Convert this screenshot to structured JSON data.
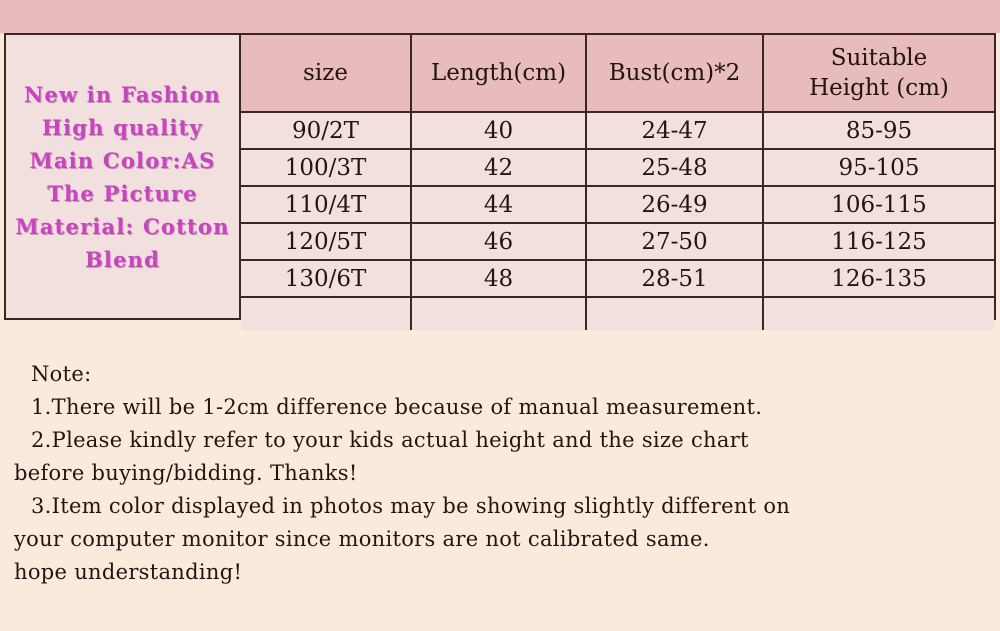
{
  "promo": {
    "lines": [
      "New in Fashion",
      "High quality",
      "Main Color:AS",
      "The Picture",
      "Material: Cotton",
      "Blend"
    ]
  },
  "colors": {
    "band": "#e8bcbd",
    "header_cell": "#e8bcbd",
    "body_cell": "#f2e0df",
    "notes_bg": "#fbeadb",
    "border": "#3d2520",
    "promo_text": "#c845c0",
    "body_text": "#241410"
  },
  "size_chart": {
    "columns": [
      "size",
      "Length(cm)",
      "Bust(cm)*2",
      "Suitable Height (cm)"
    ],
    "column_header_lines": {
      "suitable_height_line1": "Suitable",
      "suitable_height_line2": "Height (cm)"
    },
    "rows": [
      {
        "size": "90/2T",
        "length": "40",
        "bust": "24-47",
        "height": "85-95"
      },
      {
        "size": "100/3T",
        "length": "42",
        "bust": "25-48",
        "height": "95-105"
      },
      {
        "size": "110/4T",
        "length": "44",
        "bust": "26-49",
        "height": "106-115"
      },
      {
        "size": "120/5T",
        "length": "46",
        "bust": "27-50",
        "height": "116-125"
      },
      {
        "size": "130/6T",
        "length": "48",
        "bust": "28-51",
        "height": "126-135"
      }
    ],
    "empty_row": {
      "size": "",
      "length": "",
      "bust": "",
      "height": ""
    }
  },
  "notes": {
    "title": "Note:",
    "lines": [
      "1.There will be 1-2cm difference because of manual measurement.",
      "2.Please kindly refer to your kids actual height and the size chart",
      "before buying/bidding. Thanks!",
      "3.Item color displayed in photos may be showing slightly different on",
      "your computer monitor since monitors are not calibrated same.",
      "hope understanding!"
    ]
  }
}
